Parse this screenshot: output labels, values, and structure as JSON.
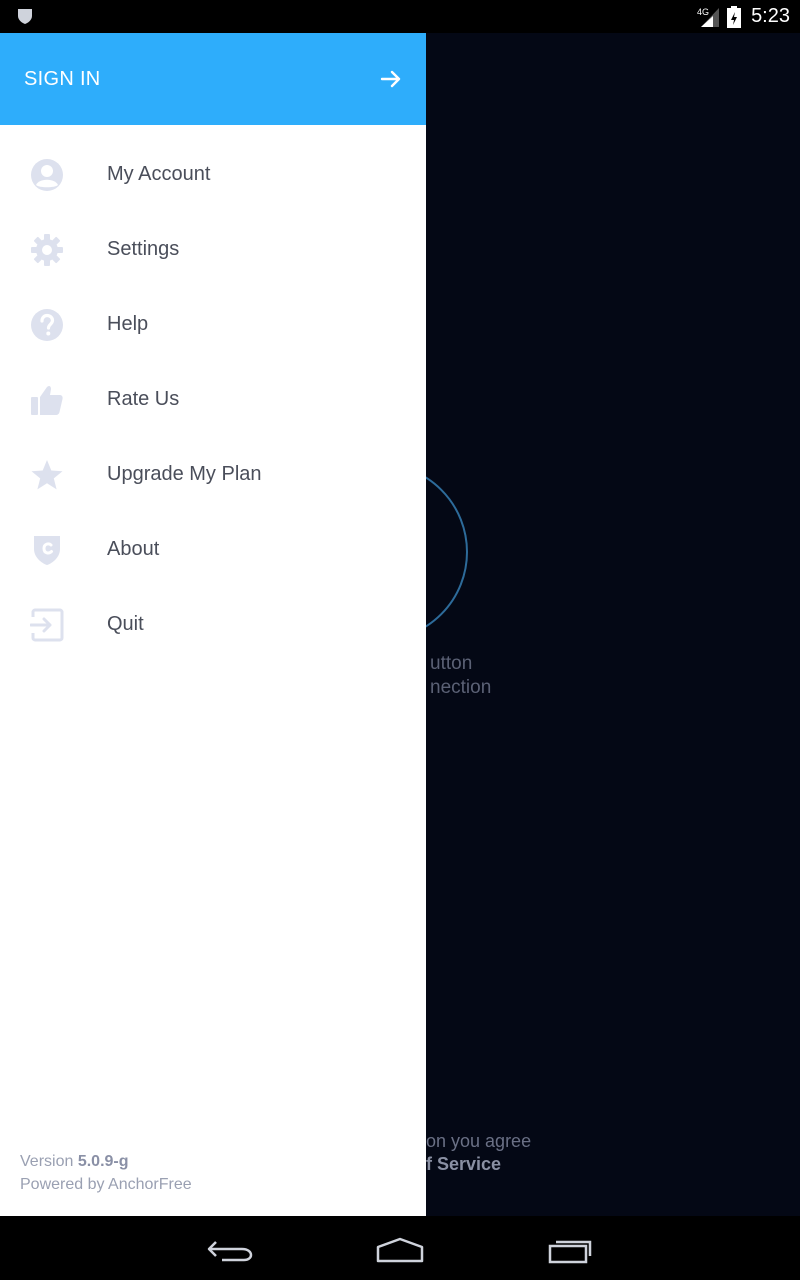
{
  "status_bar": {
    "time": "5:23",
    "network": "4G"
  },
  "background": {
    "hint_line1": "utton",
    "hint_line2": "nection",
    "terms_line1": "on you agree",
    "terms_line2": "f Service"
  },
  "drawer": {
    "sign_in_label": "SIGN IN",
    "menu": [
      {
        "label": "My Account",
        "icon": "account-icon"
      },
      {
        "label": "Settings",
        "icon": "gear-icon"
      },
      {
        "label": "Help",
        "icon": "help-icon"
      },
      {
        "label": "Rate Us",
        "icon": "thumbs-up-icon"
      },
      {
        "label": "Upgrade My Plan",
        "icon": "star-icon"
      },
      {
        "label": "About",
        "icon": "shield-icon"
      },
      {
        "label": "Quit",
        "icon": "exit-icon"
      }
    ],
    "footer": {
      "version_prefix": "Version",
      "version": "5.0.9-g",
      "powered_by": "Powered by AnchorFree"
    }
  },
  "colors": {
    "accent": "#2eadfb",
    "icon": "#dde1ee",
    "background": "#040815"
  }
}
